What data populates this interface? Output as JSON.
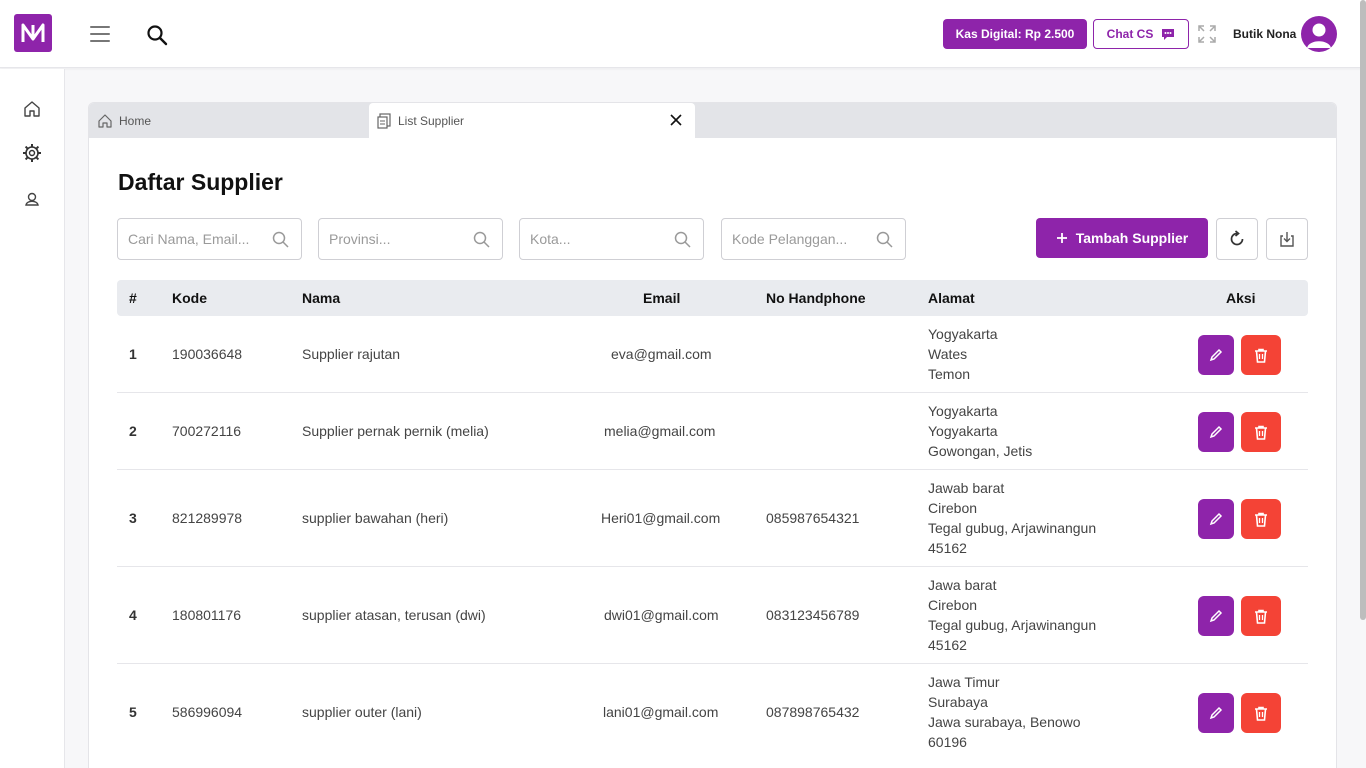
{
  "header": {
    "kas_label": "Kas Digital: Rp 2.500",
    "chat_label": "Chat CS",
    "user_name": "Butik Nona",
    "accent": "#8e24aa"
  },
  "tabs": [
    {
      "label": "Home",
      "icon": "home-icon"
    },
    {
      "label": "List Supplier",
      "icon": "document-icon"
    }
  ],
  "page": {
    "title": "Daftar Supplier",
    "filters": [
      {
        "placeholder": "Cari Nama, Email..."
      },
      {
        "placeholder": "Provinsi..."
      },
      {
        "placeholder": "Kota..."
      },
      {
        "placeholder": "Kode Pelanggan..."
      }
    ],
    "add_button": "Tambah Supplier"
  },
  "table": {
    "headers": [
      "#",
      "Kode",
      "Nama",
      "Email",
      "No Handphone",
      "Alamat",
      "Aksi"
    ],
    "rows": [
      {
        "no": "1",
        "kode": "190036648",
        "nama": "Supplier rajutan",
        "email": "eva@gmail.com",
        "phone": "",
        "alamat": [
          "Yogyakarta",
          "Wates",
          "Temon"
        ]
      },
      {
        "no": "2",
        "kode": "700272116",
        "nama": "Supplier pernak pernik (melia)",
        "email": "melia@gmail.com",
        "phone": "",
        "alamat": [
          "Yogyakarta",
          "Yogyakarta",
          "Gowongan, Jetis"
        ]
      },
      {
        "no": "3",
        "kode": "821289978",
        "nama": "supplier bawahan (heri)",
        "email": "Heri01@gmail.com",
        "phone": "085987654321",
        "alamat": [
          "Jawab barat",
          "Cirebon",
          "Tegal gubug, Arjawinangun",
          "45162"
        ]
      },
      {
        "no": "4",
        "kode": "180801176",
        "nama": "supplier atasan, terusan (dwi)",
        "email": "dwi01@gmail.com",
        "phone": "083123456789",
        "alamat": [
          "Jawa barat",
          "Cirebon",
          "Tegal gubug, Arjawinangun",
          "45162"
        ]
      },
      {
        "no": "5",
        "kode": "586996094",
        "nama": "supplier outer (lani)",
        "email": "lani01@gmail.com",
        "phone": "087898765432",
        "alamat": [
          "Jawa Timur",
          "Surabaya",
          "Jawa surabaya, Benowo",
          "60196"
        ]
      }
    ]
  }
}
